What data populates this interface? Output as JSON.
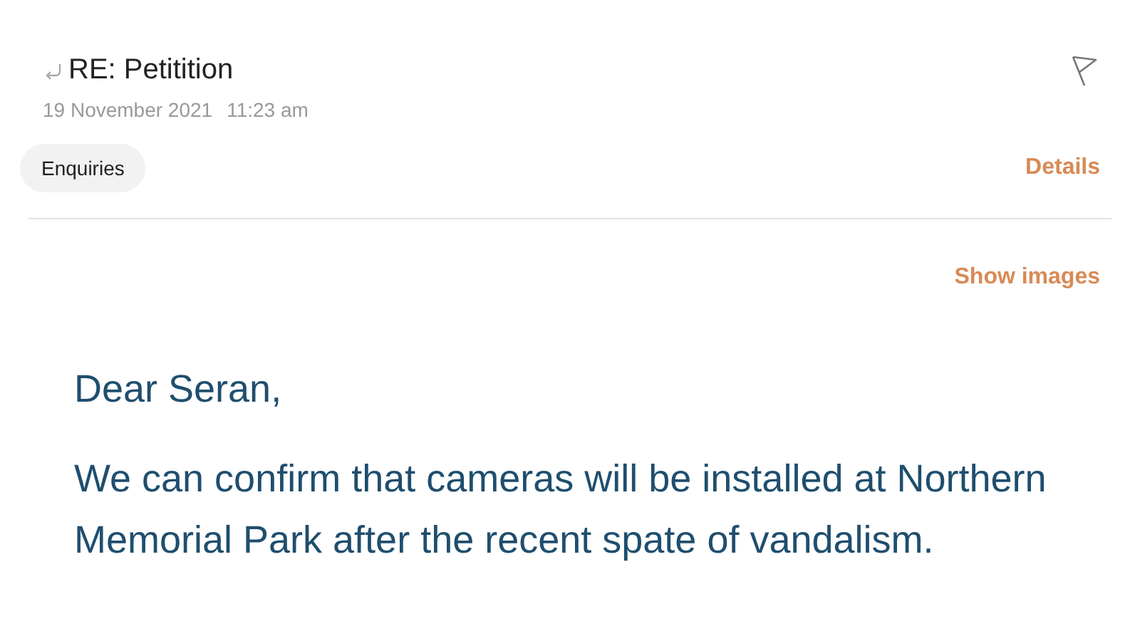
{
  "message": {
    "subject": "RE: Petitition",
    "replied": true,
    "date": "19 November 2021",
    "time": "11:23 am",
    "flagged": false,
    "folder": "Enquiries",
    "details_link": "Details",
    "show_images_link": "Show images"
  },
  "body": {
    "greeting": "Dear Seran,",
    "paragraph": "We can confirm that cameras will be installed at Northern Memorial Park after the recent spate of vandalism."
  }
}
